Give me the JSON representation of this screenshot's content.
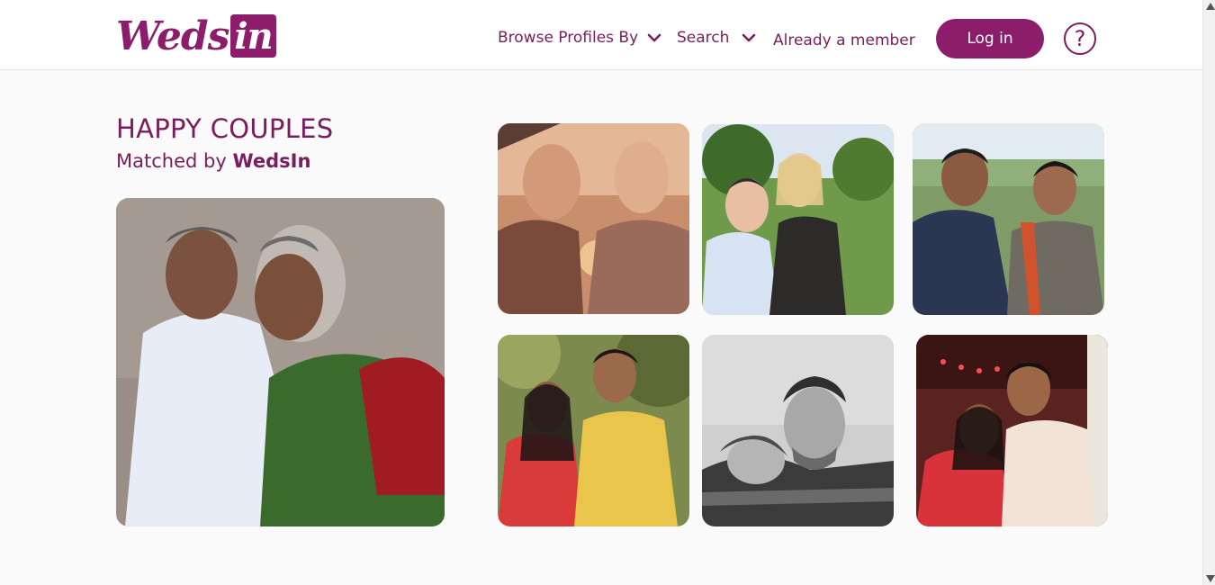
{
  "brand": {
    "logo_text": "Weds",
    "logo_box_text": "in",
    "color": "#8b1d6b"
  },
  "nav": {
    "browse_label": "Browse Profiles By",
    "search_label": "Search",
    "member_label": "Already a member",
    "login_label": "Log in",
    "help_label": "?"
  },
  "section": {
    "title": "HAPPY COUPLES",
    "subtitle_prefix": "Matched by ",
    "subtitle_brand": "WedsIn"
  },
  "photos": [
    {
      "name": "older-indian-couple-photo",
      "palette": [
        "#9a8e86",
        "#e8ecf6",
        "#3b6b2c"
      ]
    },
    {
      "name": "two-men-couple-photo",
      "palette": [
        "#c98f6c",
        "#7a4a3b",
        "#e4b896"
      ]
    },
    {
      "name": "young-couple-park-photo",
      "palette": [
        "#6e9a4a",
        "#dce6f1",
        "#2d2a2a"
      ]
    },
    {
      "name": "couple-outdoors-photo",
      "palette": [
        "#7f9b68",
        "#2a3652",
        "#6f6a62"
      ]
    },
    {
      "name": "couple-traditional-dress-photo",
      "palette": [
        "#7c8a4d",
        "#d93a3a",
        "#e9c64b"
      ]
    },
    {
      "name": "black-white-couple-photo",
      "palette": [
        "#cfcfcf",
        "#3b3b3b",
        "#8a8a8a"
      ]
    },
    {
      "name": "couple-festive-photo",
      "palette": [
        "#5a2320",
        "#d8333a",
        "#f3e3d6"
      ]
    }
  ]
}
